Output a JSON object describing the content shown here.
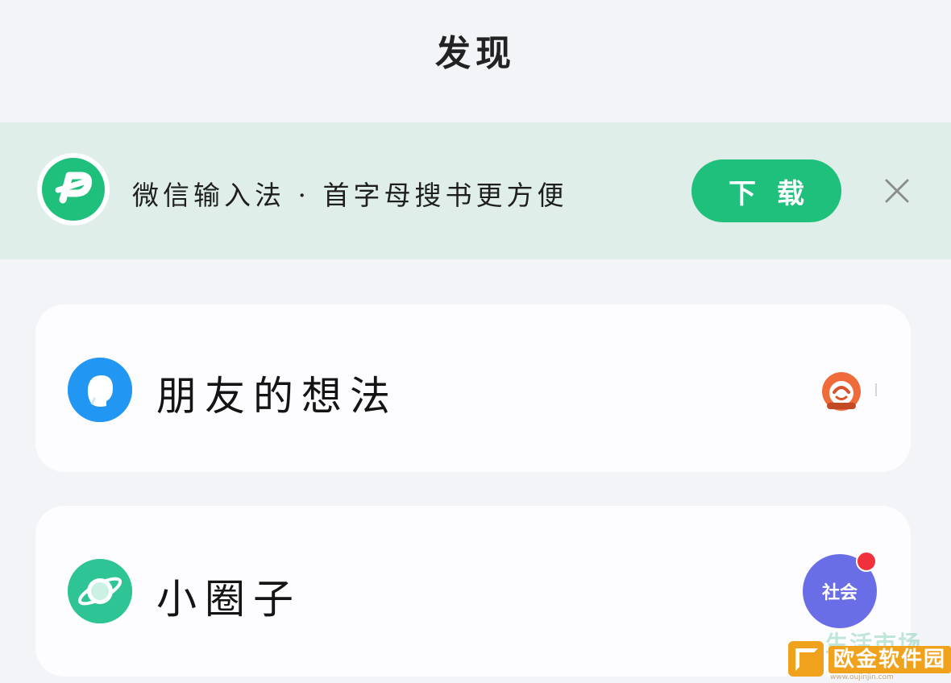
{
  "header": {
    "title": "发现"
  },
  "banner": {
    "text": "微信输入法 · 首字母搜书更方便",
    "download_label": "下载",
    "logo_icon": "wechat-input-method-icon",
    "close_icon": "close-icon",
    "accent_color": "#1fbf7c",
    "background_color": "#dfeee9"
  },
  "menu": {
    "items": [
      {
        "label": "朋友的想法",
        "icon": "friend-thoughts-icon",
        "icon_color": "#2196f3",
        "trailing": "friend-avatar"
      },
      {
        "label": "小圈子",
        "icon": "planet-icon",
        "icon_color": "#2ec495",
        "trailing_badge": "社会",
        "badge_color": "#6a6ee6",
        "has_red_dot": true
      }
    ]
  },
  "watermark": {
    "ghost_text": "生活市场",
    "brand": "欧金软件园",
    "url": "www.oujinjin.com"
  }
}
